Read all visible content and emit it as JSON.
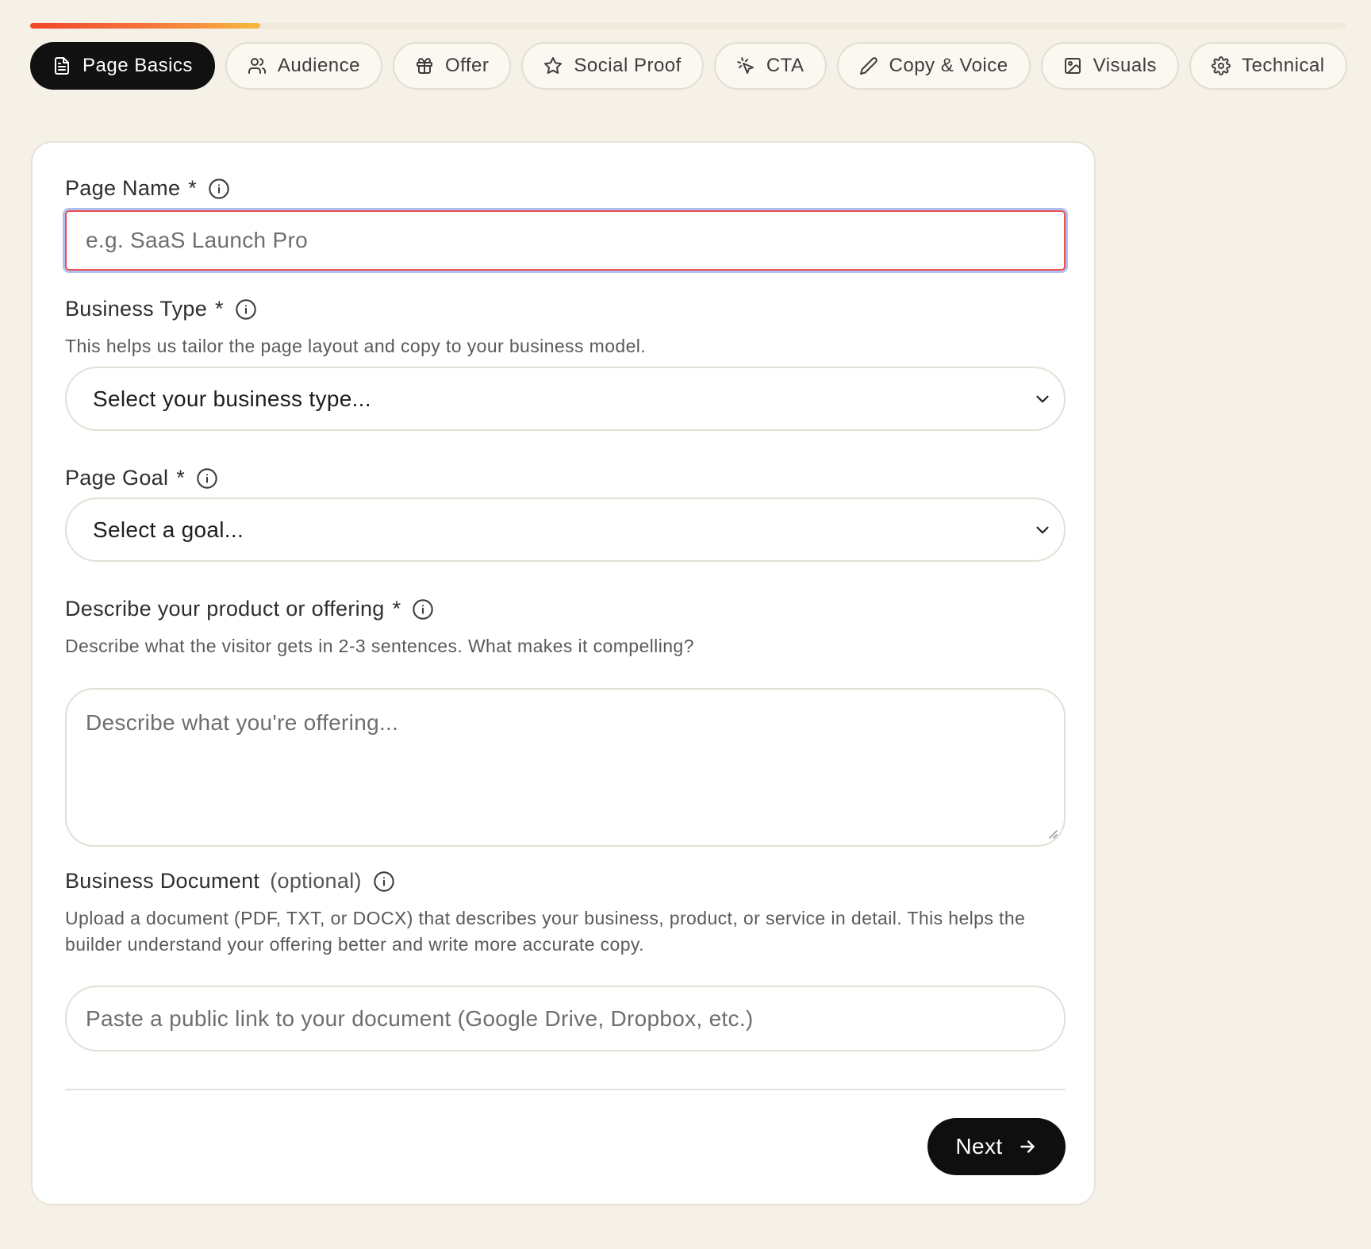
{
  "progress": {
    "fraction": 0.175,
    "colors": [
      "#f0452a",
      "#f7b841"
    ]
  },
  "tabs": [
    {
      "label": "Page Basics",
      "icon": "document-icon",
      "active": true
    },
    {
      "label": "Audience",
      "icon": "users-icon",
      "active": false
    },
    {
      "label": "Offer",
      "icon": "gift-icon",
      "active": false
    },
    {
      "label": "Social Proof",
      "icon": "star-icon",
      "active": false
    },
    {
      "label": "CTA",
      "icon": "cursor-click-icon",
      "active": false
    },
    {
      "label": "Copy & Voice",
      "icon": "pencil-icon",
      "active": false
    },
    {
      "label": "Visuals",
      "icon": "image-icon",
      "active": false
    },
    {
      "label": "Technical",
      "icon": "gear-icon",
      "active": false
    }
  ],
  "form": {
    "page_name": {
      "label": "Page Name",
      "required_mark": "*",
      "placeholder": "e.g. SaaS Launch Pro",
      "value": ""
    },
    "business_type": {
      "label": "Business Type",
      "required_mark": "*",
      "helper": "This helps us tailor the page layout and copy to your business model.",
      "selected": "Select your business type..."
    },
    "page_goal": {
      "label": "Page Goal",
      "required_mark": "*",
      "selected": "Select a goal..."
    },
    "description": {
      "label": "Describe your product or offering",
      "required_mark": "*",
      "helper": "Describe what the visitor gets in 2-3 sentences. What makes it compelling?",
      "placeholder": "Describe what you're offering..."
    },
    "business_document": {
      "label": "Business Document",
      "optional_text": "(optional)",
      "helper": "Upload a document (PDF, TXT, or DOCX) that describes your business, product, or service in detail. This helps the builder understand your offering better and write more accurate copy.",
      "placeholder": "Paste a public link to your document (Google Drive, Dropbox, etc.)"
    }
  },
  "footer": {
    "next_label": "Next"
  },
  "colors": {
    "background": "#f6f1e6",
    "accent_dark": "#111111",
    "error": "#ee4f4f",
    "focus_ring": "#aebff3"
  }
}
